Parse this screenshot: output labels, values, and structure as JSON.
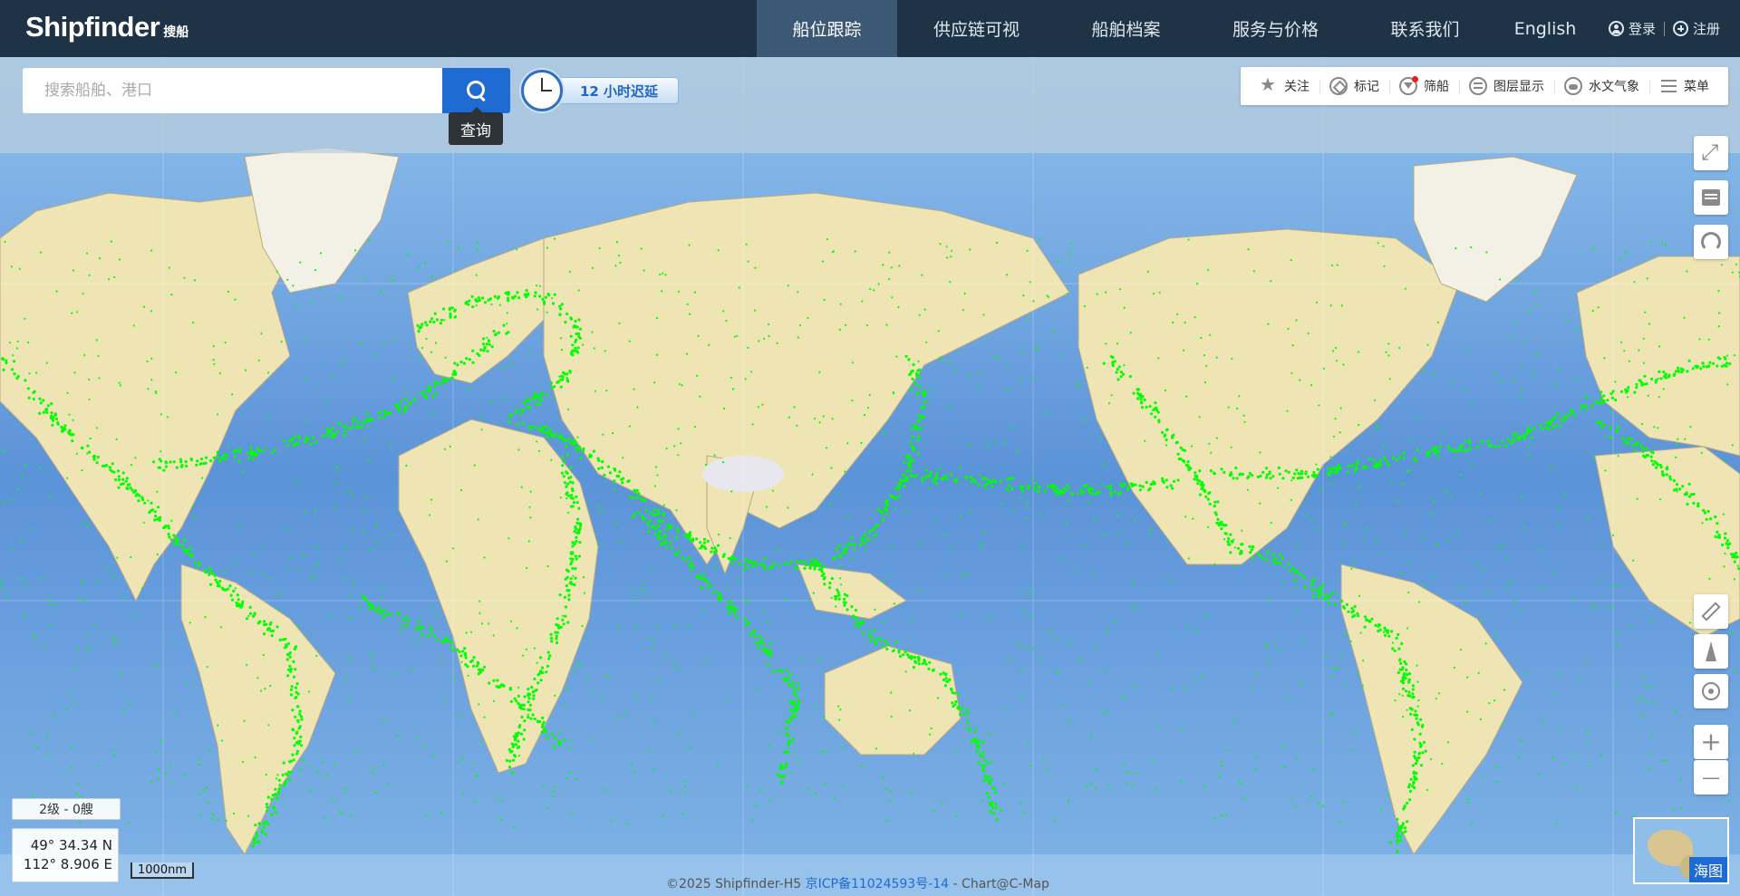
{
  "header": {
    "brand": "Shipfinder",
    "brand_cn": "搜船",
    "nav": [
      "船位跟踪",
      "供应链可视",
      "船舶档案",
      "服务与价格",
      "联系我们",
      "English"
    ],
    "active_nav": 0,
    "login": "登录",
    "register": "注册"
  },
  "search": {
    "placeholder": "搜索船舶、港口",
    "value": "",
    "button_tooltip": "查询"
  },
  "delay_badge": "12 小时迟延",
  "toolbar": {
    "items": [
      {
        "label": "关注",
        "icon": "star-icon"
      },
      {
        "label": "标记",
        "icon": "tag-icon"
      },
      {
        "label": "筛船",
        "icon": "filter-icon"
      },
      {
        "label": "图层显示",
        "icon": "layers-icon"
      },
      {
        "label": "水文气象",
        "icon": "weather-icon"
      },
      {
        "label": "菜单",
        "icon": "menu-icon"
      }
    ]
  },
  "map_controls": {
    "top": [
      "fullscreen-icon",
      "shop-icon",
      "support-icon"
    ],
    "middle": [
      "ruler-icon",
      "compass-icon",
      "locate-icon"
    ],
    "zoom_in": "+",
    "zoom_out": "—"
  },
  "status": {
    "level": "2级 - 0艘",
    "lat": "49° 34.34 N",
    "lon": "112° 8.906 E",
    "scale": "1000nm"
  },
  "footer": {
    "copyright": "©2025 Shipfinder-H5",
    "icp": "京ICP备11024593号-14",
    "chart": "- Chart@C-Map"
  },
  "minimap": {
    "label": "海图"
  },
  "colors": {
    "header_bg": "#1f3347",
    "active_nav_bg": "#3b5874",
    "accent": "#1f6bd4",
    "vessel": "#00ff00",
    "ocean": "#5a92d6",
    "land": "#efe4b4"
  }
}
